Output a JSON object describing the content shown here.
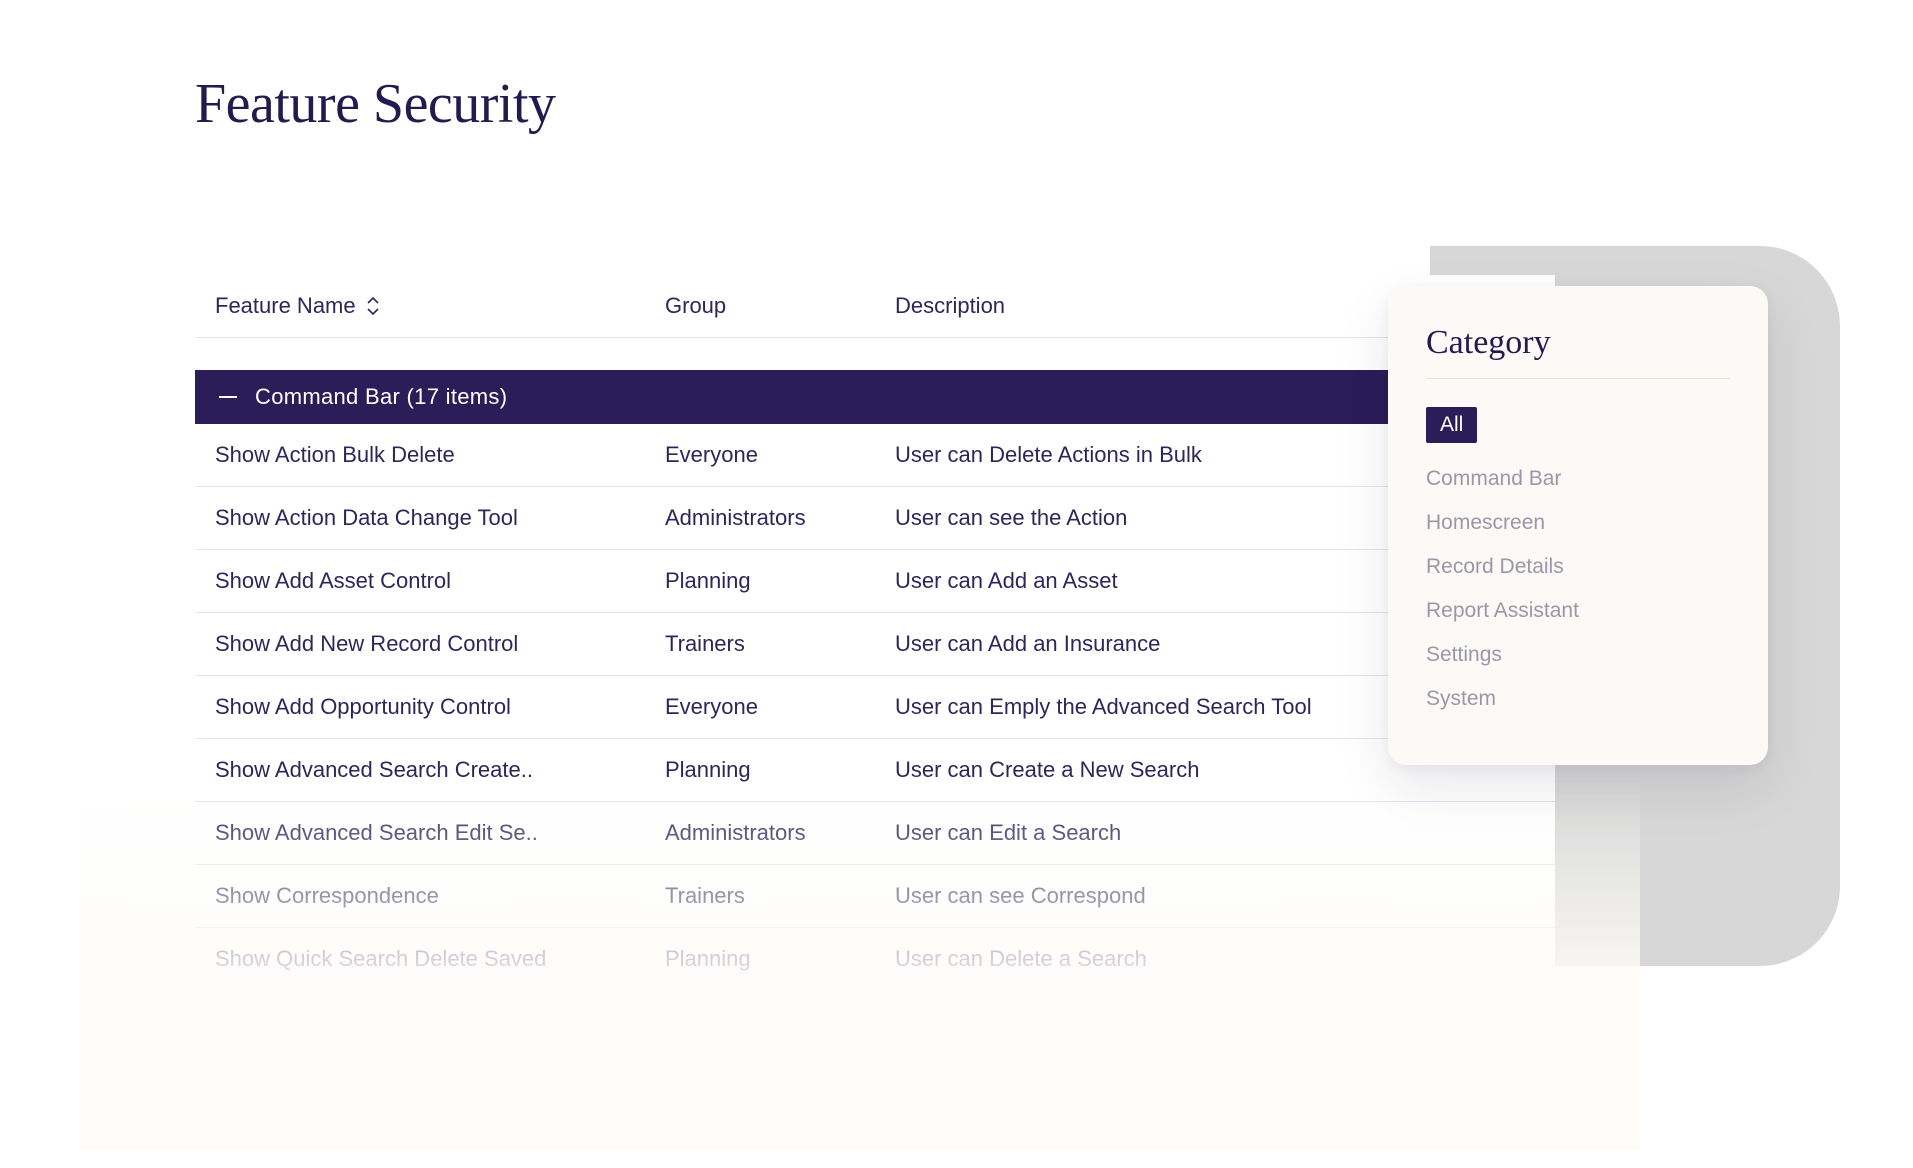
{
  "page": {
    "title": "Feature Security"
  },
  "table": {
    "columns": {
      "name": "Feature  Name",
      "group": "Group",
      "description": "Description"
    },
    "group_header": "Command Bar (17 items)",
    "rows": [
      {
        "name": "Show Action Bulk Delete",
        "group": "Everyone",
        "description": "User can Delete Actions in Bulk"
      },
      {
        "name": "Show Action Data Change Tool",
        "group": "Administrators",
        "description": "User can see the Action"
      },
      {
        "name": "Show Add Asset Control",
        "group": "Planning",
        "description": "User can Add an Asset"
      },
      {
        "name": "Show Add New Record Control",
        "group": "Trainers",
        "description": "User can Add an Insurance"
      },
      {
        "name": "Show Add Opportunity Control",
        "group": "Everyone",
        "description": "User can Emply the Advanced Search Tool"
      },
      {
        "name": "Show Advanced Search Create..",
        "group": "Planning",
        "description": "User can Create a New Search"
      },
      {
        "name": "Show Advanced Search Edit Se..",
        "group": "Administrators",
        "description": "User can Edit a Search"
      },
      {
        "name": "Show Correspondence",
        "group": "Trainers",
        "description": "User can see Correspond"
      },
      {
        "name": "Show Quick Search Delete Saved",
        "group": "Planning",
        "description": "User can Delete a Search"
      }
    ]
  },
  "sidebar": {
    "title": "Category",
    "items": [
      {
        "label": "All",
        "active": true
      },
      {
        "label": "Command Bar",
        "active": false
      },
      {
        "label": "Homescreen",
        "active": false
      },
      {
        "label": "Record Details",
        "active": false
      },
      {
        "label": "Report Assistant",
        "active": false
      },
      {
        "label": "Settings",
        "active": false
      },
      {
        "label": "System",
        "active": false
      }
    ]
  }
}
